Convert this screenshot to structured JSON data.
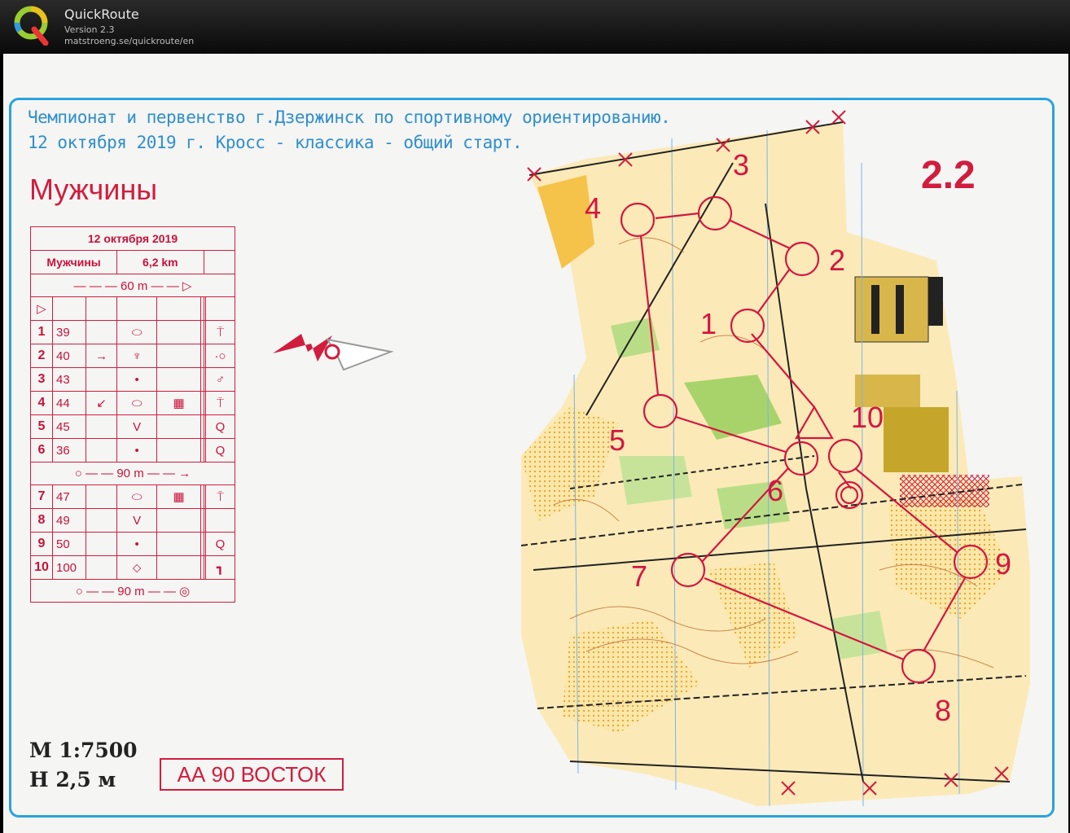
{
  "app": {
    "name": "QuickRoute",
    "version": "Version 2.3",
    "url": "matstroeng.se/quickroute/en"
  },
  "map": {
    "title_line1": "Чемпионат и первенство г.Дзержинск по спортивному ориентированию.",
    "title_line2": "12 октября 2019 г. Кросс - классика - общий старт.",
    "category": "Мужчины",
    "course_code": "2.2",
    "scale": "M 1:7500",
    "contour": "H 2,5 м",
    "start_location": "АА 90 ВОСТОК",
    "control_labels": [
      "1",
      "2",
      "3",
      "4",
      "5",
      "6",
      "7",
      "8",
      "9",
      "10"
    ]
  },
  "description_sheet": {
    "date": "12 октября 2019",
    "category": "Мужчины",
    "length": "6,2 km",
    "start_distance": "60 m",
    "mid_distance": "90 m",
    "finish_distance": "90 m",
    "controls": [
      {
        "num": "1",
        "code": "39",
        "dir": "",
        "feature": "⬭",
        "detail": "",
        "loc": "⍑"
      },
      {
        "num": "2",
        "code": "40",
        "dir": "→",
        "feature": "♆",
        "detail": "",
        "loc": "·○"
      },
      {
        "num": "3",
        "code": "43",
        "dir": "",
        "feature": "•",
        "detail": "",
        "loc": "♂"
      },
      {
        "num": "4",
        "code": "44",
        "dir": "↙",
        "feature": "⬭",
        "detail": "▦",
        "loc": "⍑"
      },
      {
        "num": "5",
        "code": "45",
        "dir": "",
        "feature": "V",
        "detail": "",
        "loc": "Q"
      },
      {
        "num": "6",
        "code": "36",
        "dir": "",
        "feature": "•",
        "detail": "",
        "loc": "Q"
      },
      {
        "num": "7",
        "code": "47",
        "dir": "",
        "feature": "⬭",
        "detail": "▦",
        "loc": "⍑"
      },
      {
        "num": "8",
        "code": "49",
        "dir": "",
        "feature": "V",
        "detail": "",
        "loc": ""
      },
      {
        "num": "9",
        "code": "50",
        "dir": "",
        "feature": "•",
        "detail": "",
        "loc": "Q"
      },
      {
        "num": "10",
        "code": "100",
        "dir": "",
        "feature": "⬦",
        "detail": "",
        "loc": "┓"
      }
    ]
  }
}
